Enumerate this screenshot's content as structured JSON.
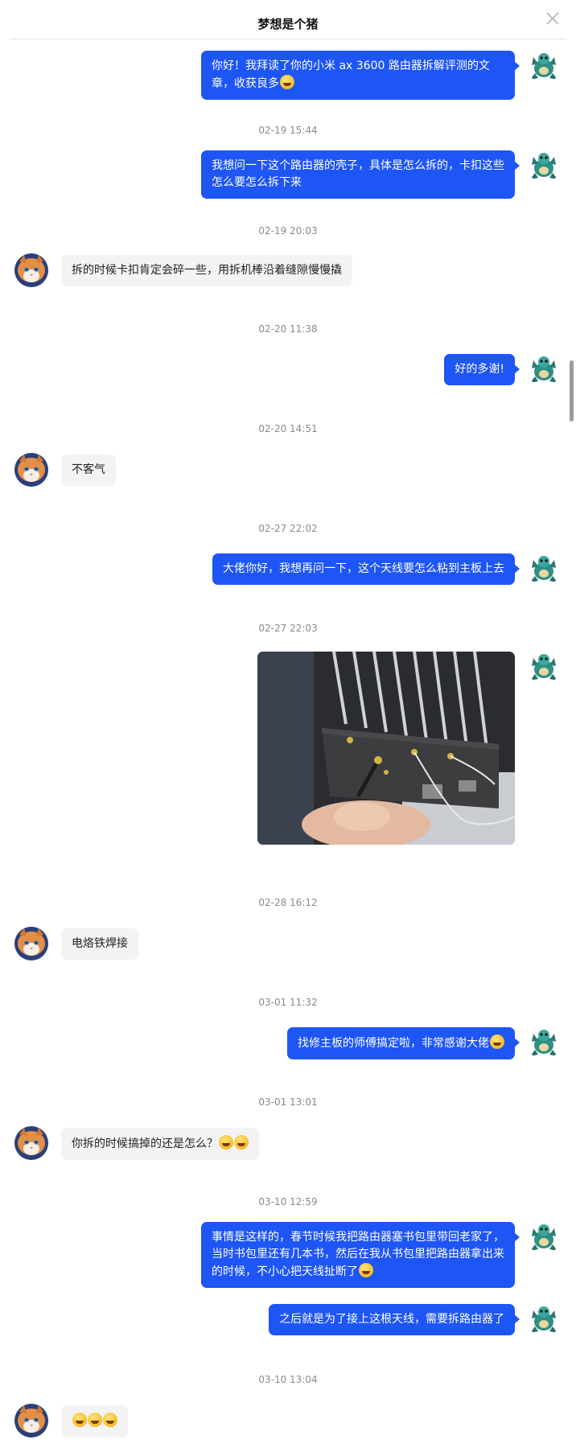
{
  "header": {
    "title": "梦想是个猪",
    "close_icon": "close-icon"
  },
  "colors": {
    "outgoing_bubble": "#1e55f5",
    "incoming_bubble": "#f3f3f3",
    "timestamp": "#8a8a8a"
  },
  "thread": [
    {
      "kind": "out",
      "text": "你好！我拜读了你的小米 ax 3600 路由器拆解评测的文章，收获良多",
      "emoji": "rofl-emoji"
    },
    {
      "kind": "time",
      "text": "02-19 15:44"
    },
    {
      "kind": "out",
      "text": "我想问一下这个路由器的壳子，具体是怎么拆的，卡扣这些怎么要怎么拆下来"
    },
    {
      "kind": "time",
      "text": "02-19 20:03"
    },
    {
      "kind": "in",
      "text": "拆的时候卡扣肯定会碎一些，用拆机棒沿着缝隙慢慢撬"
    },
    {
      "kind": "time",
      "text": "02-20 11:38"
    },
    {
      "kind": "out",
      "text": "好的多谢!"
    },
    {
      "kind": "time",
      "text": "02-20 14:51"
    },
    {
      "kind": "in",
      "text": "不客气"
    },
    {
      "kind": "time",
      "text": "02-27 22:02"
    },
    {
      "kind": "out",
      "text": "大佬你好，我想再问一下，这个天线要怎么粘到主板上去"
    },
    {
      "kind": "time",
      "text": "02-27 22:03"
    },
    {
      "kind": "out-image",
      "image": "router-board-photo"
    },
    {
      "kind": "time",
      "text": "02-28 16:12"
    },
    {
      "kind": "in",
      "text": "电烙铁焊接"
    },
    {
      "kind": "time",
      "text": "03-01 11:32"
    },
    {
      "kind": "out",
      "text": "找修主板的师傅搞定啦，非常感谢大佬",
      "emoji": "rofl-emoji"
    },
    {
      "kind": "time",
      "text": "03-01 13:01"
    },
    {
      "kind": "in",
      "text": "你拆的时候搞掉的还是怎么？",
      "emoji_count": 2
    },
    {
      "kind": "time",
      "text": "03-10 12:59"
    },
    {
      "kind": "out",
      "text": "事情是这样的，春节时候我把路由器塞书包里带回老家了，当时书包里还有几本书，然后在我从书包里把路由器拿出来的时候，不小心把天线扯断了",
      "emoji": "sweat-smile-emoji"
    },
    {
      "kind": "out",
      "text": "之后就是为了接上这根天线，需要拆路由器了"
    },
    {
      "kind": "time",
      "text": "03-10 13:04"
    },
    {
      "kind": "in",
      "text": "",
      "emoji_count": 3
    }
  ]
}
